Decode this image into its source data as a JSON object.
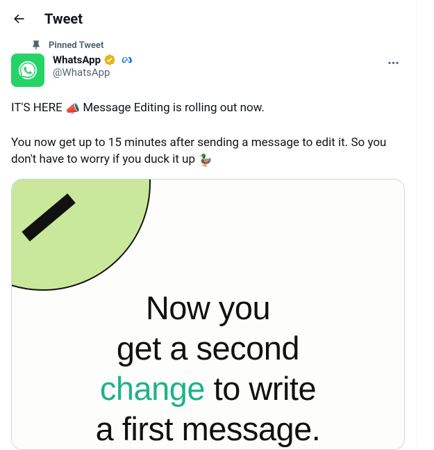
{
  "header": {
    "title": "Tweet"
  },
  "tweet": {
    "pinned_label": "Pinned Tweet",
    "author": {
      "display_name": "WhatsApp",
      "handle": "@WhatsApp",
      "verified_color": "#e2b719",
      "affiliate_icon": "meta"
    },
    "body": {
      "line1_pre": "IT'S HERE ",
      "line1_post": " Message Editing is rolling out now.",
      "line2_pre": "You now get up to 15 minutes after sending a message to edit it. So you don't have to worry if you duck it up ",
      "megaphone_emoji": "📣",
      "duck_emoji": "🦆"
    },
    "media": {
      "line1": "Now you",
      "line2": "get a second",
      "accent_word": "change",
      "line3_rest": " to write",
      "line4": "a first message."
    }
  }
}
